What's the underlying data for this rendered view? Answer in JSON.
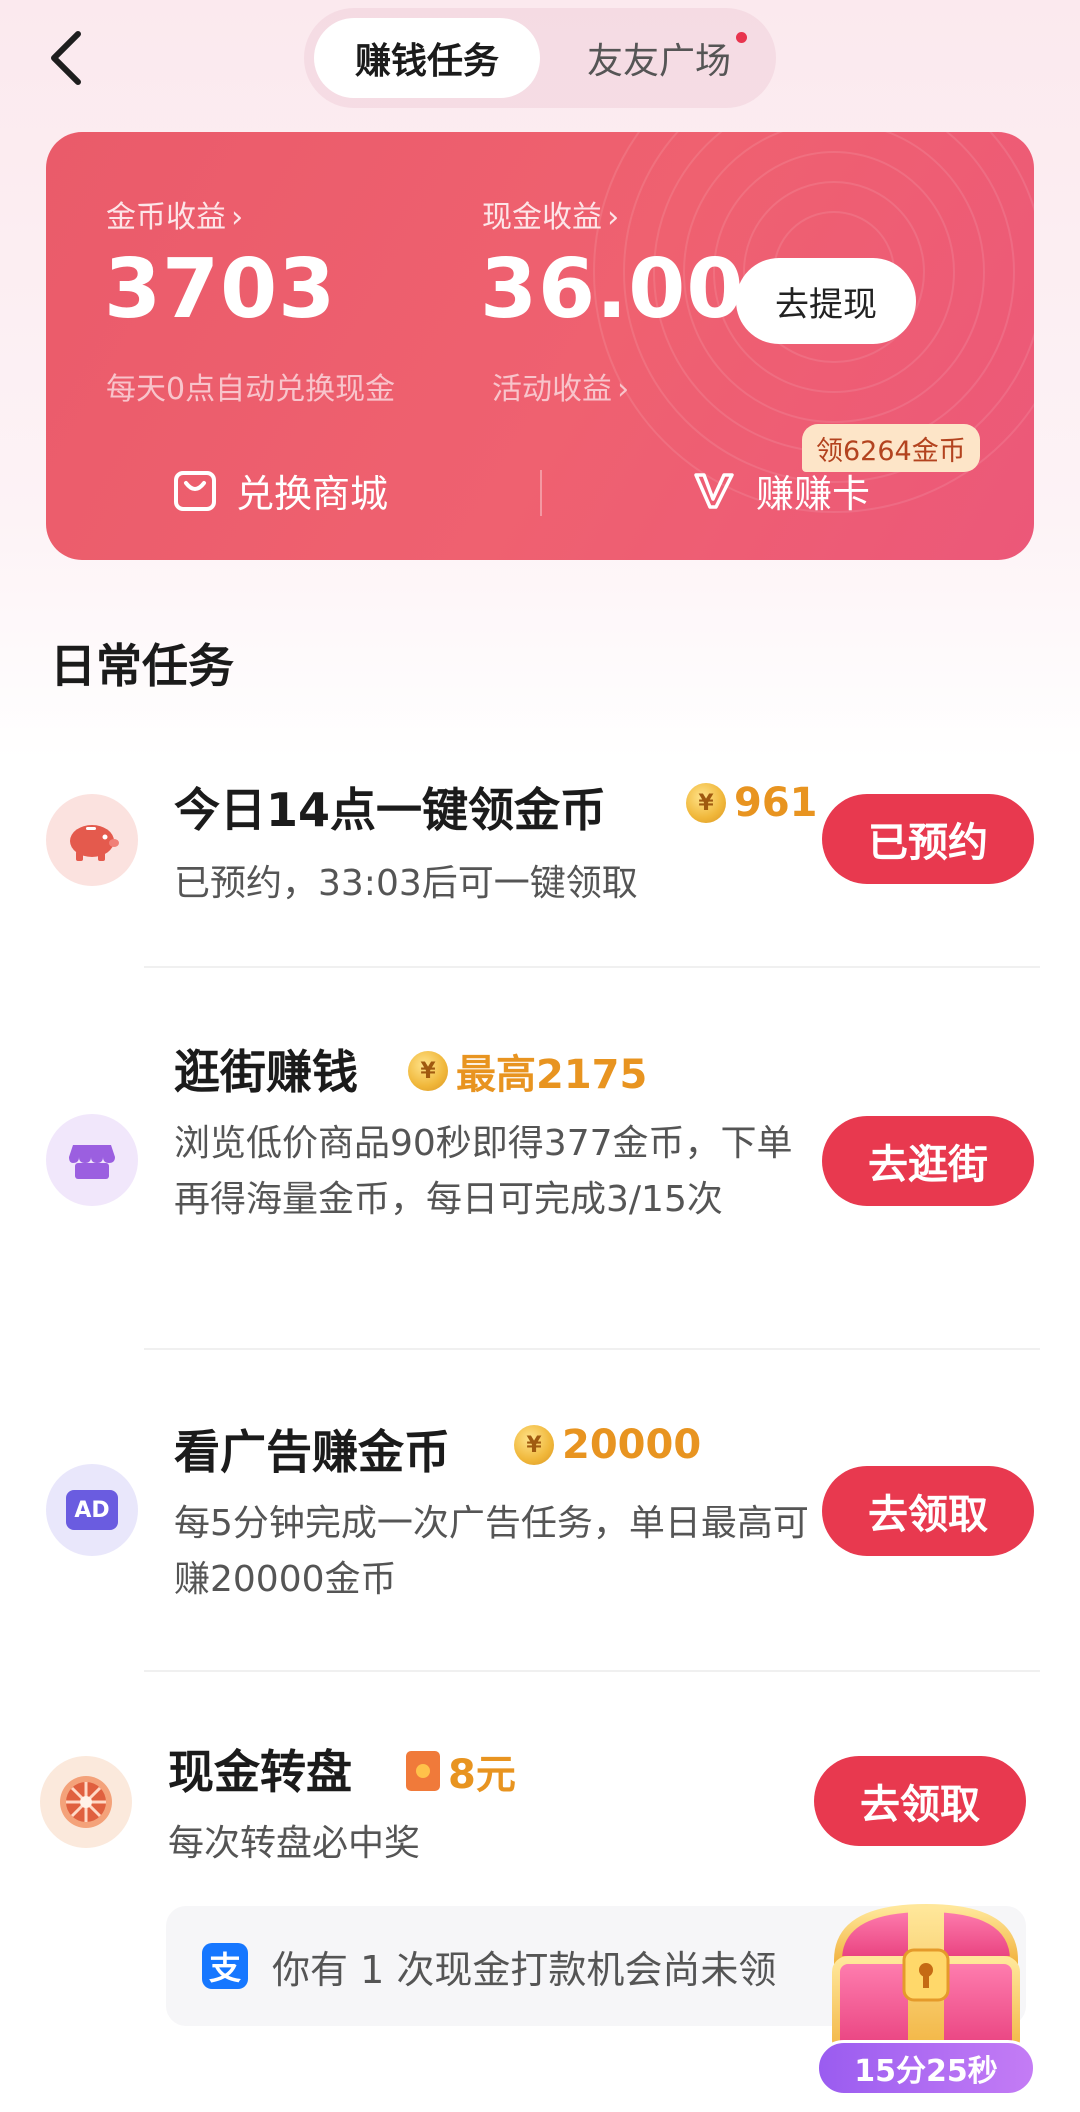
{
  "header": {
    "tabs": [
      {
        "label": "赚钱任务",
        "active": true
      },
      {
        "label": "友友广场",
        "active": false,
        "has_dot": true
      }
    ]
  },
  "earnings": {
    "coin_label": "金币收益",
    "coin_value": "3703",
    "coin_sub": "每天0点自动兑换现金",
    "cash_label": "现金收益",
    "cash_value": "36.00",
    "cash_sub": "活动收益",
    "withdraw_label": "去提现",
    "mall_label": "兑换商城",
    "earn_card_label": "赚赚卡",
    "promo_tag": "领6264金币"
  },
  "section_title": "日常任务",
  "tasks": [
    {
      "title": "今日14点一键领金币",
      "reward": "961",
      "desc": "已预约，33:03后可一键领取",
      "button": "已预约",
      "icon": "piggy-bank-icon"
    },
    {
      "title": "逛街赚钱",
      "reward": "最高2175",
      "desc": "浏览低价商品90秒即得377金币，下单再得海量金币，每日可完成3/15次",
      "button": "去逛街",
      "icon": "shop-icon"
    },
    {
      "title": "看广告赚金币",
      "reward": "20000",
      "desc": "每5分钟完成一次广告任务，单日最高可赚20000金币",
      "button": "去领取",
      "icon": "ad-icon",
      "icon_text": "AD"
    },
    {
      "title": "现金转盘",
      "reward": "8元",
      "desc": "每次转盘必中奖",
      "button": "去领取",
      "icon": "wheel-icon"
    }
  ],
  "notice": {
    "text": "你有 1 次现金打款机会尚未领",
    "icon": "alipay-icon",
    "icon_text": "支"
  },
  "treasure": {
    "timer": "15分25秒",
    "icon": "treasure-chest-icon"
  },
  "colors": {
    "accent": "#e8394f",
    "card": "#ef6170",
    "reward": "#e89420"
  }
}
